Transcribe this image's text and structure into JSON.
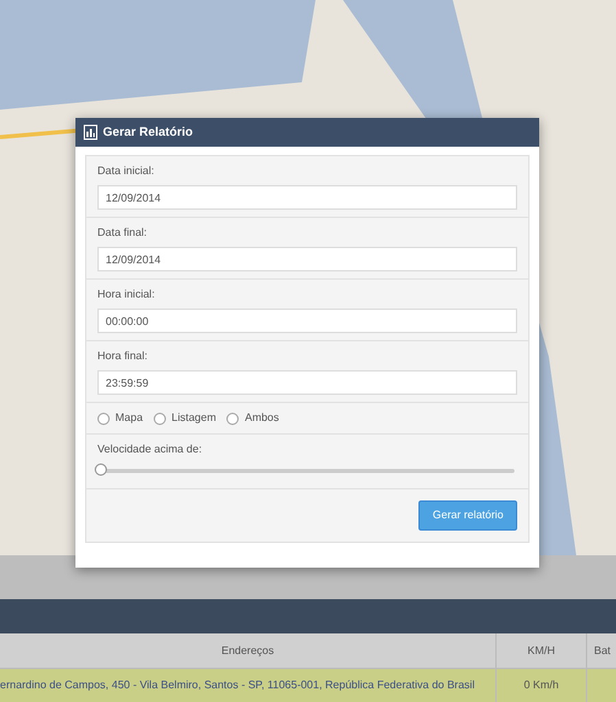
{
  "dialog": {
    "title": "Gerar Relatório",
    "fields": [
      {
        "label": "Data inicial:",
        "value": "12/09/2014"
      },
      {
        "label": "Data final:",
        "value": "12/09/2014"
      },
      {
        "label": "Hora inicial:",
        "value": "00:00:00"
      },
      {
        "label": "Hora final:",
        "value": "23:59:59"
      }
    ],
    "options": [
      {
        "label": "Mapa",
        "selected": false
      },
      {
        "label": "Listagem",
        "selected": false
      },
      {
        "label": "Ambos",
        "selected": false
      }
    ],
    "speed": {
      "label": "Velocidade acima de:",
      "level": 0
    },
    "button": "Gerar relatório"
  },
  "table": {
    "columns": [
      "Endereços",
      "KM/H",
      "Bat"
    ],
    "rows": [
      [
        "ernardino de Campos, 450 - Vila Belmiro, Santos - SP, 11065-001, República Federativa do Brasil",
        "0 Km/h",
        ""
      ]
    ]
  }
}
